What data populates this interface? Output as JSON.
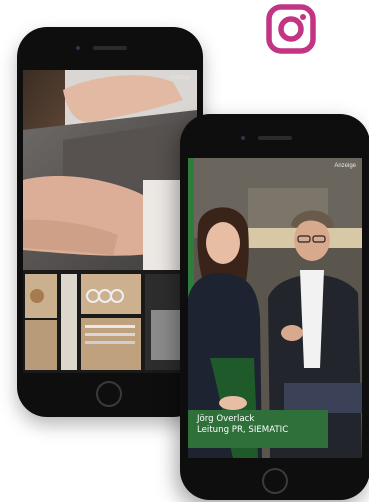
{
  "ad_label": "Anzeige",
  "caption": {
    "name": "Jörg Overlack",
    "role": "Leitung PR, SIEMATIC"
  },
  "colors": {
    "instagram": "#c13584",
    "caption_bg": "#2f6f3a",
    "phone_body": "#0e0e0f"
  },
  "icons": [
    "instagram-icon"
  ]
}
